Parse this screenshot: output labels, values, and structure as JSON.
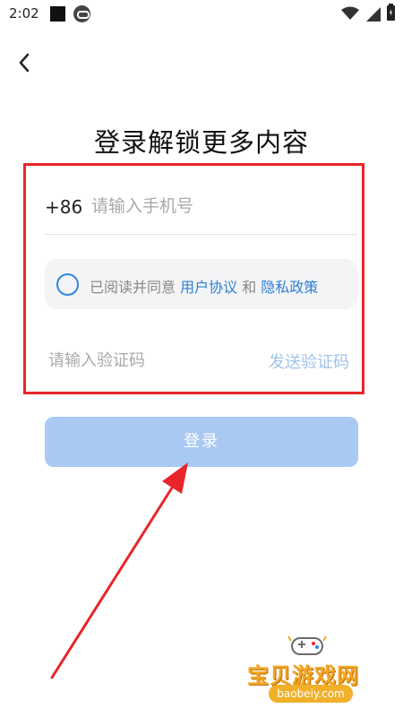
{
  "status_bar": {
    "time": "2:02"
  },
  "page": {
    "title": "登录解锁更多内容"
  },
  "phone": {
    "country_code": "+86",
    "placeholder": "请输入手机号"
  },
  "agreement": {
    "prefix": "已阅读并同意 ",
    "user_agreement": "用户协议",
    "conjunction": " 和 ",
    "privacy_policy": "隐私政策",
    "checked": false
  },
  "verification": {
    "placeholder": "请输入验证码",
    "send_label": "发送验证码"
  },
  "login": {
    "label": "登录"
  },
  "watermark": {
    "title": "宝贝游戏网",
    "url": "baobeiy.com"
  },
  "colors": {
    "accent": "#2d87e4",
    "highlight": "#e8252a",
    "login_disabled": "#a9c9f3",
    "watermark": "#f5a623"
  }
}
